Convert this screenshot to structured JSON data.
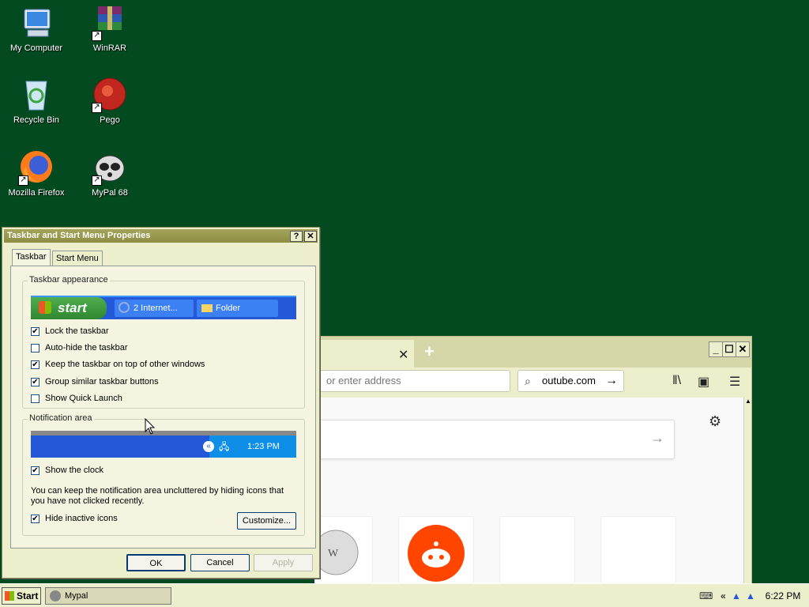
{
  "desktop": {
    "icons": [
      {
        "label": "My Computer"
      },
      {
        "label": "WinRAR"
      },
      {
        "label": "Recycle Bin"
      },
      {
        "label": "Pego"
      },
      {
        "label": "Mozilla Firefox"
      },
      {
        "label": "MyPal 68"
      }
    ]
  },
  "browser": {
    "tab_close": "✕",
    "new_tab": "+",
    "address_placeholder": "or enter address",
    "search_text": "outube.com",
    "controls": {
      "minimize": "_",
      "maximize": "☐",
      "close": "✕"
    }
  },
  "dialog": {
    "title": "Taskbar and Start Menu Properties",
    "help_button": "?",
    "close_button": "✕",
    "tabs": [
      "Taskbar",
      "Start Menu"
    ],
    "appearance_group": "Taskbar appearance",
    "preview": {
      "start": "start",
      "btn1": "2 Internet...",
      "btn2": "Folder"
    },
    "options": [
      {
        "label": "Lock the taskbar",
        "checked": true
      },
      {
        "label": "Auto-hide the taskbar",
        "checked": false
      },
      {
        "label": "Keep the taskbar on top of other windows",
        "checked": true
      },
      {
        "label": "Group similar taskbar buttons",
        "checked": true
      },
      {
        "label": "Show Quick Launch",
        "checked": false
      }
    ],
    "notification_group": "Notification area",
    "notif_time": "1:23 PM",
    "show_clock": {
      "label": "Show the clock",
      "checked": true
    },
    "description": "You can keep the notification area uncluttered by hiding icons that you have not clicked recently.",
    "hide_inactive": {
      "label": "Hide inactive icons",
      "checked": true
    },
    "customize_button": "Customize...",
    "ok_button": "OK",
    "cancel_button": "Cancel",
    "apply_button": "Apply"
  },
  "taskbar": {
    "start": "Start",
    "task": "Mypal",
    "tray_expand": "«",
    "clock": "6:22 PM"
  }
}
